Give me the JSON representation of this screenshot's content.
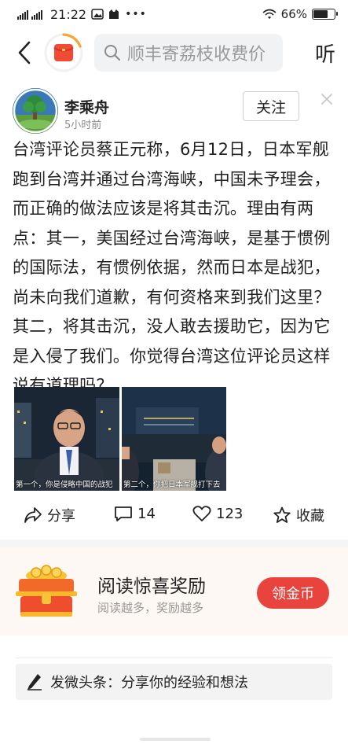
{
  "status_bar": {
    "network1": "4G HD",
    "network2": "4G HD",
    "time": "21:22",
    "battery": "66%",
    "battery_level": 0.66
  },
  "nav": {
    "search_placeholder": "顺丰寄荔枝收费价",
    "listen_label": "听",
    "icons": [
      "back-arrow-icon",
      "red-packet-icon",
      "search-icon"
    ]
  },
  "author": {
    "name": "李乘舟",
    "time": "5小时前",
    "follow_label": "关注"
  },
  "post": {
    "text": "台湾评论员蔡正元称，6月12日，日本军舰跑到台湾并通过台湾海峡，中国未予理会，而正确的做法应该是将其击沉。理由有两点：其一，美国经过台湾海峡，是基于惯例的国际法，有惯例依据，然而日本是战犯，尚未向我们道歉，有何资格来到我们这里？其二，将其击沉，没人敢去援助它，因为它是入侵了我们。你觉得台湾这位评论员这样说有道理吗？",
    "images": [
      {
        "caption": "第一个，你是侵略中国的战犯"
      },
      {
        "caption": "第二个，你把日本军舰打下去"
      }
    ]
  },
  "actions": {
    "share_label": "分享",
    "comment_count": "14",
    "like_count": "123",
    "favorite_label": "收藏"
  },
  "reward": {
    "title": "阅读惊喜奖励",
    "subtitle": "阅读越多，奖励越多",
    "button_label": "领金币"
  },
  "compose": {
    "label": "发微头条：分享你的经验和想法"
  },
  "colors": {
    "accent_red": "#e8433d",
    "reward_bg": "#fdf8f4",
    "search_bg": "#f1f2f4"
  }
}
